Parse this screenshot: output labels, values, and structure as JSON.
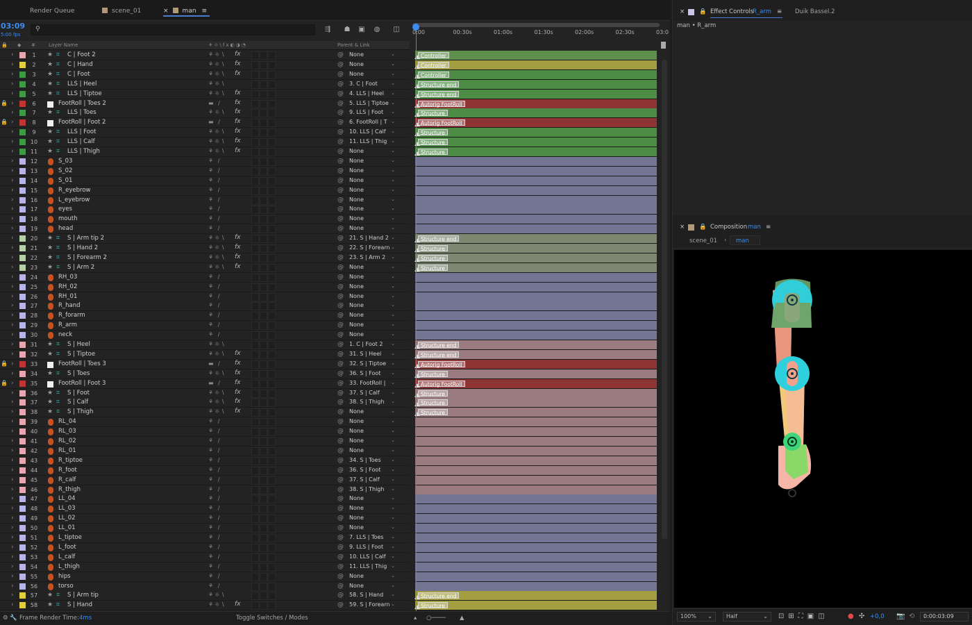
{
  "tabs": {
    "render_queue": "Render Queue",
    "scene": "scene_01",
    "man": "man"
  },
  "timecode": "03:09",
  "fps": "5:00 fps",
  "colhdr": {
    "num": "#",
    "layer_name": "Layer Name",
    "parent": "Parent & Link"
  },
  "ruler": [
    "0:00",
    "00:30s",
    "01:00s",
    "01:30s",
    "02:00s",
    "02:30s",
    "03:0"
  ],
  "layers": [
    {
      "n": "1",
      "c": "#e8a6b0",
      "name": "C | Foot 2",
      "t": "null",
      "parent": "None",
      "fx": true,
      "track": "#5f8f4d",
      "label": "Controller",
      "lock": false
    },
    {
      "n": "2",
      "c": "#e2cf3e",
      "name": "C | Hand",
      "t": "null",
      "parent": "None",
      "fx": true,
      "track": "#a39e40",
      "label": "Controller",
      "lock": false
    },
    {
      "n": "3",
      "c": "#3f9a46",
      "name": "C | Foot",
      "t": "null",
      "parent": "None",
      "fx": true,
      "track": "#4c8c45",
      "label": "Controller",
      "lock": false
    },
    {
      "n": "4",
      "c": "#3f9a46",
      "name": "LLS | Heel",
      "t": "null",
      "parent": "3. C | Foot",
      "fx": false,
      "track": "#4c8c45",
      "label": "Structure end",
      "lock": false
    },
    {
      "n": "5",
      "c": "#3f9a46",
      "name": "LLS | Tiptoe",
      "t": "null",
      "parent": "4. LLS | Heel",
      "fx": true,
      "track": "#4c8c45",
      "label": "Structure end",
      "lock": false
    },
    {
      "n": "6",
      "c": "#c03434",
      "name": "FootRoll | Toes 2",
      "t": "solid",
      "parent": "5. LLS | Tiptoe",
      "fx": true,
      "track": "#8f3434",
      "label": "Autorig FootRoll",
      "lock": true
    },
    {
      "n": "7",
      "c": "#3f9a46",
      "name": "LLS | Toes",
      "t": "null",
      "parent": "9. LLS | Foot",
      "fx": true,
      "track": "#4c8c45",
      "label": "Structure",
      "lock": false
    },
    {
      "n": "8",
      "c": "#c03434",
      "name": "FootRoll | Foot 2",
      "t": "solid",
      "parent": "6. FootRoll | T",
      "fx": true,
      "track": "#8f3434",
      "label": "Autorig FootRoll",
      "lock": true
    },
    {
      "n": "9",
      "c": "#3f9a46",
      "name": "LLS | Foot",
      "t": "null",
      "parent": "10. LLS | Calf",
      "fx": true,
      "track": "#4c8c45",
      "label": "Structure",
      "lock": false
    },
    {
      "n": "10",
      "c": "#3f9a46",
      "name": "LLS | Calf",
      "t": "null",
      "parent": "11. LLS | Thig",
      "fx": true,
      "track": "#4c8c45",
      "label": "Structure",
      "lock": false
    },
    {
      "n": "11",
      "c": "#3f9a46",
      "name": "LLS | Thigh",
      "t": "null",
      "parent": "None",
      "fx": true,
      "track": "#4c8c45",
      "label": "Structure",
      "lock": false
    },
    {
      "n": "12",
      "c": "#b7b4e8",
      "name": "S_03",
      "t": "shape",
      "parent": "None",
      "fx": false,
      "track": "#747493",
      "label": "",
      "lock": false
    },
    {
      "n": "13",
      "c": "#b7b4e8",
      "name": "S_02",
      "t": "shape",
      "parent": "None",
      "fx": false,
      "track": "#747493",
      "label": "",
      "lock": false
    },
    {
      "n": "14",
      "c": "#b7b4e8",
      "name": "S_01",
      "t": "shape",
      "parent": "None",
      "fx": false,
      "track": "#747493",
      "label": "",
      "lock": false
    },
    {
      "n": "15",
      "c": "#b7b4e8",
      "name": "R_eyebrow",
      "t": "shape",
      "parent": "None",
      "fx": false,
      "track": "#747493",
      "label": "",
      "lock": false
    },
    {
      "n": "16",
      "c": "#b7b4e8",
      "name": "L_eyebrow",
      "t": "shape",
      "parent": "None",
      "fx": false,
      "track": "#747493",
      "label": "",
      "lock": false
    },
    {
      "n": "17",
      "c": "#b7b4e8",
      "name": "eyes",
      "t": "shape",
      "parent": "None",
      "fx": false,
      "track": "#747493",
      "label": "",
      "lock": false
    },
    {
      "n": "18",
      "c": "#b7b4e8",
      "name": "mouth",
      "t": "shape",
      "parent": "None",
      "fx": false,
      "track": "#747493",
      "label": "",
      "lock": false
    },
    {
      "n": "19",
      "c": "#b7b4e8",
      "name": "head",
      "t": "shape",
      "parent": "None",
      "fx": false,
      "track": "#747493",
      "label": "",
      "lock": false
    },
    {
      "n": "20",
      "c": "#b6cfa6",
      "name": "S | Arm tip 2",
      "t": "null",
      "parent": "21. S | Hand 2",
      "fx": true,
      "track": "#7c8872",
      "label": "Structure end",
      "lock": false
    },
    {
      "n": "21",
      "c": "#b6cfa6",
      "name": "S | Hand 2",
      "t": "null",
      "parent": "22. S | Forearn",
      "fx": true,
      "track": "#7c8872",
      "label": "Structure",
      "lock": false
    },
    {
      "n": "22",
      "c": "#b6cfa6",
      "name": "S | Forearm 2",
      "t": "null",
      "parent": "23. S | Arm 2",
      "fx": true,
      "track": "#7c8872",
      "label": "Structure",
      "lock": false
    },
    {
      "n": "23",
      "c": "#b6cfa6",
      "name": "S | Arm 2",
      "t": "null",
      "parent": "None",
      "fx": true,
      "track": "#7c8872",
      "label": "Structure",
      "lock": false
    },
    {
      "n": "24",
      "c": "#b7b4e8",
      "name": "RH_03",
      "t": "shape",
      "parent": "None",
      "fx": false,
      "track": "#747493",
      "label": "",
      "lock": false
    },
    {
      "n": "25",
      "c": "#b7b4e8",
      "name": "RH_02",
      "t": "shape",
      "parent": "None",
      "fx": false,
      "track": "#747493",
      "label": "",
      "lock": false
    },
    {
      "n": "26",
      "c": "#b7b4e8",
      "name": "RH_01",
      "t": "shape",
      "parent": "None",
      "fx": false,
      "track": "#747493",
      "label": "",
      "lock": false
    },
    {
      "n": "27",
      "c": "#b7b4e8",
      "name": "R_hand",
      "t": "shape",
      "parent": "None",
      "fx": false,
      "track": "#747493",
      "label": "",
      "lock": false
    },
    {
      "n": "28",
      "c": "#b7b4e8",
      "name": "R_forarm",
      "t": "shape",
      "parent": "None",
      "fx": false,
      "track": "#747493",
      "label": "",
      "lock": false
    },
    {
      "n": "29",
      "c": "#b7b4e8",
      "name": "R_arm",
      "t": "shape",
      "parent": "None",
      "fx": false,
      "track": "#747493",
      "label": "",
      "lock": false
    },
    {
      "n": "30",
      "c": "#b7b4e8",
      "name": "neck",
      "t": "shape",
      "parent": "None",
      "fx": false,
      "track": "#747493",
      "label": "",
      "lock": false
    },
    {
      "n": "31",
      "c": "#e8a6b0",
      "name": "S | Heel",
      "t": "null",
      "parent": "1. C | Foot 2",
      "fx": false,
      "track": "#9a7c80",
      "label": "Structure end",
      "lock": false
    },
    {
      "n": "32",
      "c": "#e8a6b0",
      "name": "S | Tiptoe",
      "t": "null",
      "parent": "31. S | Heel",
      "fx": true,
      "track": "#9a7c80",
      "label": "Structure end",
      "lock": false
    },
    {
      "n": "33",
      "c": "#c03434",
      "name": "FootRoll | Toes 3",
      "t": "solid",
      "parent": "32. S | Tiptoe",
      "fx": true,
      "track": "#8f3434",
      "label": "Autorig FootRoll",
      "lock": true
    },
    {
      "n": "34",
      "c": "#e8a6b0",
      "name": "S | Toes",
      "t": "null",
      "parent": "36. S | Foot",
      "fx": true,
      "track": "#9a7c80",
      "label": "Structure",
      "lock": false
    },
    {
      "n": "35",
      "c": "#c03434",
      "name": "FootRoll | Foot 3",
      "t": "solid",
      "parent": "33. FootRoll |",
      "fx": true,
      "track": "#8f3434",
      "label": "Autorig FootRoll",
      "lock": true
    },
    {
      "n": "36",
      "c": "#e8a6b0",
      "name": "S | Foot",
      "t": "null",
      "parent": "37. S | Calf",
      "fx": true,
      "track": "#9a7c80",
      "label": "Structure",
      "lock": false
    },
    {
      "n": "37",
      "c": "#e8a6b0",
      "name": "S | Calf",
      "t": "null",
      "parent": "38. S | Thigh",
      "fx": true,
      "track": "#9a7c80",
      "label": "Structure",
      "lock": false
    },
    {
      "n": "38",
      "c": "#e8a6b0",
      "name": "S | Thigh",
      "t": "null",
      "parent": "None",
      "fx": true,
      "track": "#9a7c80",
      "label": "Structure",
      "lock": false
    },
    {
      "n": "39",
      "c": "#e8a6b0",
      "name": "RL_04",
      "t": "shape",
      "parent": "None",
      "fx": false,
      "track": "#9a7c80",
      "label": "",
      "lock": false
    },
    {
      "n": "40",
      "c": "#e8a6b0",
      "name": "RL_03",
      "t": "shape",
      "parent": "None",
      "fx": false,
      "track": "#9a7c80",
      "label": "",
      "lock": false
    },
    {
      "n": "41",
      "c": "#e8a6b0",
      "name": "RL_02",
      "t": "shape",
      "parent": "None",
      "fx": false,
      "track": "#9a7c80",
      "label": "",
      "lock": false
    },
    {
      "n": "42",
      "c": "#e8a6b0",
      "name": "RL_01",
      "t": "shape",
      "parent": "None",
      "fx": false,
      "track": "#9a7c80",
      "label": "",
      "lock": false
    },
    {
      "n": "43",
      "c": "#e8a6b0",
      "name": "R_tiptoe",
      "t": "shape",
      "parent": "34. S | Toes",
      "fx": false,
      "track": "#9a7c80",
      "label": "",
      "lock": false
    },
    {
      "n": "44",
      "c": "#e8a6b0",
      "name": "R_foot",
      "t": "shape",
      "parent": "36. S | Foot",
      "fx": false,
      "track": "#9a7c80",
      "label": "",
      "lock": false
    },
    {
      "n": "45",
      "c": "#e8a6b0",
      "name": "R_calf",
      "t": "shape",
      "parent": "37. S | Calf",
      "fx": false,
      "track": "#9a7c80",
      "label": "",
      "lock": false
    },
    {
      "n": "46",
      "c": "#e8a6b0",
      "name": "R_thigh",
      "t": "shape",
      "parent": "38. S | Thigh",
      "fx": false,
      "track": "#9a7c80",
      "label": "",
      "lock": false
    },
    {
      "n": "47",
      "c": "#b7b4e8",
      "name": "LL_04",
      "t": "shape",
      "parent": "None",
      "fx": false,
      "track": "#747493",
      "label": "",
      "lock": false
    },
    {
      "n": "48",
      "c": "#b7b4e8",
      "name": "LL_03",
      "t": "shape",
      "parent": "None",
      "fx": false,
      "track": "#747493",
      "label": "",
      "lock": false
    },
    {
      "n": "49",
      "c": "#b7b4e8",
      "name": "LL_02",
      "t": "shape",
      "parent": "None",
      "fx": false,
      "track": "#747493",
      "label": "",
      "lock": false
    },
    {
      "n": "50",
      "c": "#b7b4e8",
      "name": "LL_01",
      "t": "shape",
      "parent": "None",
      "fx": false,
      "track": "#747493",
      "label": "",
      "lock": false
    },
    {
      "n": "51",
      "c": "#b7b4e8",
      "name": "L_tiptoe",
      "t": "shape",
      "parent": "7. LLS | Toes",
      "fx": false,
      "track": "#747493",
      "label": "",
      "lock": false
    },
    {
      "n": "52",
      "c": "#b7b4e8",
      "name": "L_foot",
      "t": "shape",
      "parent": "9. LLS | Foot",
      "fx": false,
      "track": "#747493",
      "label": "",
      "lock": false
    },
    {
      "n": "53",
      "c": "#b7b4e8",
      "name": "L_calf",
      "t": "shape",
      "parent": "10. LLS | Calf",
      "fx": false,
      "track": "#747493",
      "label": "",
      "lock": false
    },
    {
      "n": "54",
      "c": "#b7b4e8",
      "name": "L_thigh",
      "t": "shape",
      "parent": "11. LLS | Thig",
      "fx": false,
      "track": "#747493",
      "label": "",
      "lock": false
    },
    {
      "n": "55",
      "c": "#b7b4e8",
      "name": "hips",
      "t": "shape",
      "parent": "None",
      "fx": false,
      "track": "#747493",
      "label": "",
      "lock": false
    },
    {
      "n": "56",
      "c": "#b7b4e8",
      "name": "torso",
      "t": "shape",
      "parent": "None",
      "fx": false,
      "track": "#747493",
      "label": "",
      "lock": false
    },
    {
      "n": "57",
      "c": "#e2cf3e",
      "name": "S | Arm tip",
      "t": "null",
      "parent": "58. S | Hand",
      "fx": false,
      "track": "#a39e40",
      "label": "Structure end",
      "lock": false
    },
    {
      "n": "58",
      "c": "#e2cf3e",
      "name": "S | Hand",
      "t": "null",
      "parent": "59. S | Forearn",
      "fx": true,
      "track": "#a39e40",
      "label": "Structure",
      "lock": false
    }
  ],
  "status": {
    "frame_render_label": "Frame Render Time:",
    "frame_render_value": "4ms",
    "toggle": "Toggle Switches / Modes"
  },
  "effect_controls": {
    "title": "Effect Controls",
    "layer": "R_arm",
    "other_tab": "Duik Bassel.2",
    "breadcrumb": "man • R_arm"
  },
  "composition": {
    "title": "Composition",
    "comp": "man",
    "crumb1": "scene_01",
    "crumb2": "man"
  },
  "comp_footer": {
    "zoom": "100%",
    "resolution": "Half",
    "exposure": "+0,0",
    "time": "0:00:03:09"
  }
}
